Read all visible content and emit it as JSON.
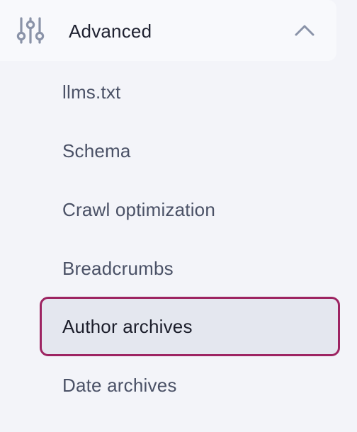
{
  "section": {
    "label": "Advanced",
    "icon": "sliders-icon",
    "toggle_icon": "chevron-up-icon",
    "expanded": true
  },
  "menu": {
    "items": [
      {
        "label": "llms.txt",
        "active": false
      },
      {
        "label": "Schema",
        "active": false
      },
      {
        "label": "Crawl optimization",
        "active": false
      },
      {
        "label": "Breadcrumbs",
        "active": false
      },
      {
        "label": "Author archives",
        "active": true
      },
      {
        "label": "Date archives",
        "active": false
      }
    ]
  },
  "colors": {
    "background": "#f3f4f9",
    "header_background": "#f8f9fc",
    "active_border": "#9d2462",
    "active_background": "#e4e7ef",
    "text": "#4a5166",
    "icon": "#8a93a8"
  }
}
